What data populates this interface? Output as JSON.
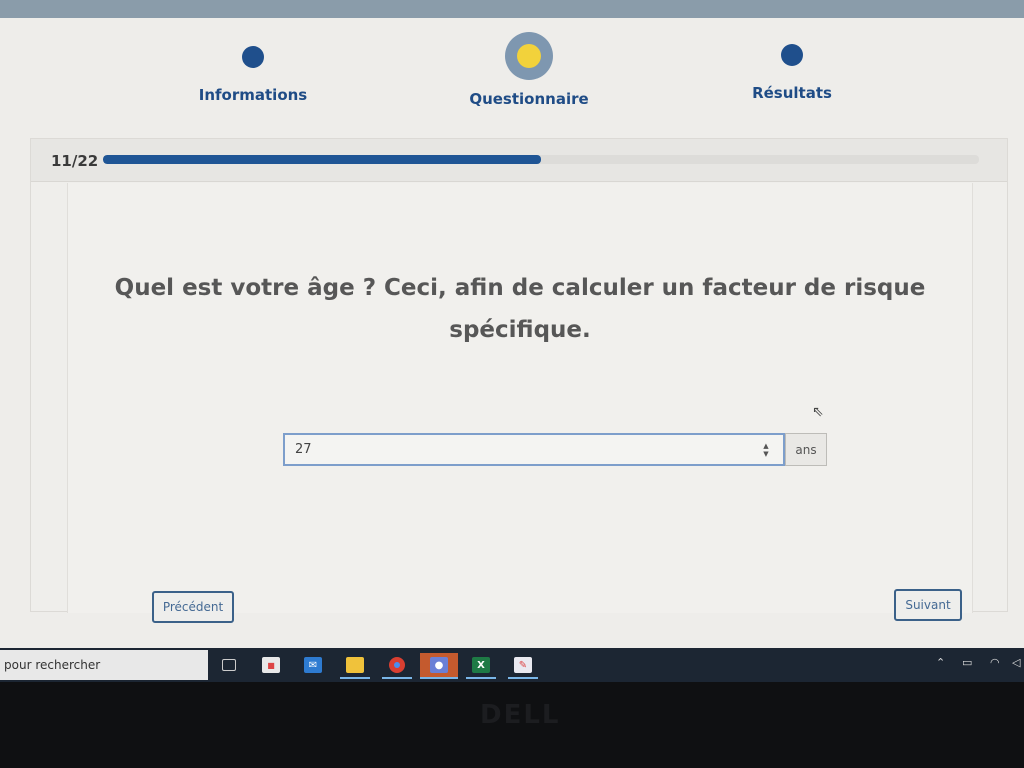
{
  "steps": [
    {
      "label": "Informations"
    },
    {
      "label": "Questionnaire"
    },
    {
      "label": "Résultats"
    }
  ],
  "progress": {
    "counter": "11/22",
    "current": 11,
    "total": 22
  },
  "question": {
    "text": "Quel est votre âge ? Ceci, afin de calculer un facteur de risque spécifique."
  },
  "age_field": {
    "value": "27",
    "unit": "ans"
  },
  "buttons": {
    "previous": "Précédent",
    "next": "Suivant"
  },
  "taskbar": {
    "search_placeholder": "pour rechercher",
    "apps": [
      "task-view-icon",
      "store-icon",
      "mail-icon",
      "file-explorer-icon",
      "chrome-icon",
      "app-icon",
      "excel-icon",
      "paint-icon"
    ]
  },
  "colors": {
    "accent": "#1f5595",
    "active_step": "#f2d23b",
    "step_ring": "#7e97b0"
  },
  "brand": {
    "bezel_logo": "DELL"
  }
}
